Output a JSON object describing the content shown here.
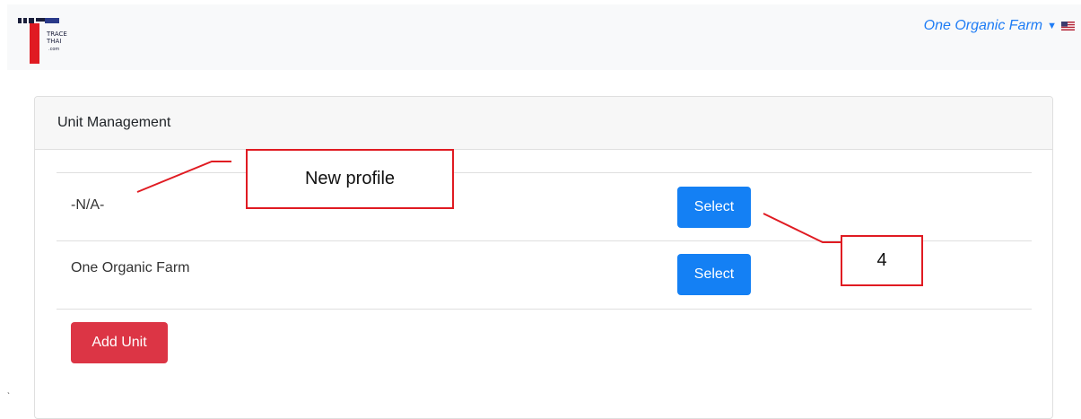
{
  "navbar": {
    "logo_text": [
      "TRACE",
      "THAI",
      ".com"
    ],
    "user_name": "One Organic Farm",
    "caret_icon": "▼",
    "flag_icon": "us-flag-icon"
  },
  "card": {
    "title": "Unit Management",
    "units": [
      {
        "name": "-N/A-",
        "button_label": "Select"
      },
      {
        "name": "One Organic Farm",
        "button_label": "Select"
      }
    ],
    "add_button_label": "Add Unit"
  },
  "annotations": {
    "callout_1": "New profile",
    "callout_2": "4",
    "color": "#e01b22"
  },
  "stray_mark": "˴",
  "colors": {
    "primary": "#1480f4",
    "danger": "#dc3545",
    "link": "#1e7cf5"
  }
}
